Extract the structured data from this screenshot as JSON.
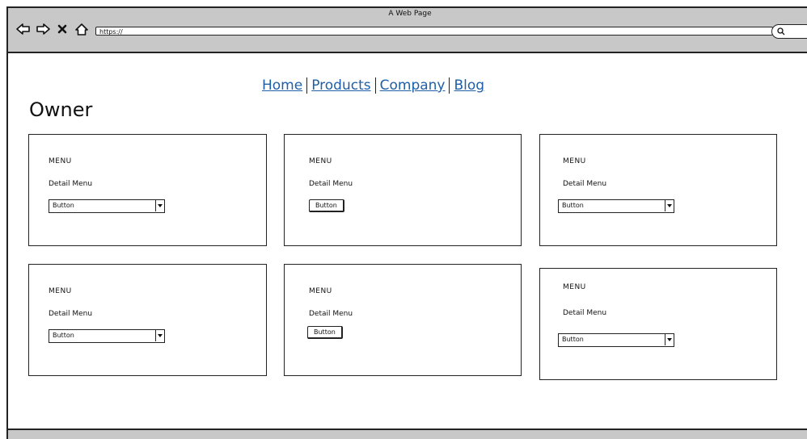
{
  "window": {
    "title": "A Web Page",
    "url": "https://"
  },
  "nav": {
    "links": [
      "Home",
      "Products",
      "Company",
      "Blog"
    ]
  },
  "page": {
    "title": "Owner"
  },
  "cards": [
    {
      "menu": "MENU",
      "detail": "Detail Menu",
      "control": "select",
      "control_label": "Button"
    },
    {
      "menu": "MENU",
      "detail": "Detail Menu",
      "control": "button",
      "control_label": "Button"
    },
    {
      "menu": "MENU",
      "detail": "Detail Menu",
      "control": "select",
      "control_label": "Button"
    },
    {
      "menu": "MENU",
      "detail": "Detail Menu",
      "control": "select",
      "control_label": "Button"
    },
    {
      "menu": "MENU",
      "detail": "Detail Menu",
      "control": "button",
      "control_label": "Button"
    },
    {
      "menu": "MENU",
      "detail": "Detail Menu",
      "control": "select",
      "control_label": "Button"
    }
  ],
  "icons": {
    "back": "arrow-left-icon",
    "forward": "arrow-right-icon",
    "stop": "close-icon",
    "home": "home-icon",
    "search": "search-icon",
    "dropdown": "chevron-down-icon"
  }
}
